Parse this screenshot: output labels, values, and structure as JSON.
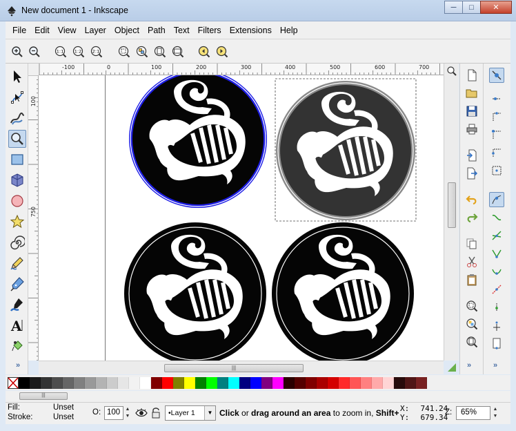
{
  "window": {
    "title": "New document 1 - Inkscape",
    "minimize": "─",
    "maximize": "□",
    "close": "✕"
  },
  "menu": [
    {
      "label": "File",
      "key": "F"
    },
    {
      "label": "Edit",
      "key": "E"
    },
    {
      "label": "View",
      "key": "V"
    },
    {
      "label": "Layer",
      "key": "L"
    },
    {
      "label": "Object",
      "key": "O"
    },
    {
      "label": "Path",
      "key": "P"
    },
    {
      "label": "Text",
      "key": "T"
    },
    {
      "label": "Filters",
      "key": "r"
    },
    {
      "label": "Extensions",
      "key": "x"
    },
    {
      "label": "Help",
      "key": "H"
    }
  ],
  "zoom_toolbar": {
    "zoom_1_1": "1:1",
    "zoom_1_2": "1:2",
    "zoom_2_1": "2:1"
  },
  "ruler": {
    "top_labels": [
      "-100",
      "0",
      "100",
      "200",
      "300",
      "400",
      "500",
      "600",
      "700"
    ],
    "left_labels": [
      "100",
      "750"
    ]
  },
  "toolbox_more": "»",
  "commands_more": "»",
  "snap_more": "»",
  "palette": {
    "colors": [
      "#000000",
      "#1a1a1a",
      "#333333",
      "#4d4d4d",
      "#666666",
      "#808080",
      "#999999",
      "#b3b3b3",
      "#cccccc",
      "#e6e6e6",
      "#f2f2f2",
      "#ffffff",
      "#800000",
      "#ff0000",
      "#808000",
      "#ffff00",
      "#008000",
      "#00ff00",
      "#008080",
      "#00ffff",
      "#000080",
      "#0000ff",
      "#800080",
      "#ff00ff",
      "#2b0000",
      "#550000",
      "#800000",
      "#aa0000",
      "#d40000",
      "#ff2a2a",
      "#ff5555",
      "#ff8080",
      "#ffaaaa",
      "#ffd5d5",
      "#280b0b",
      "#501616",
      "#782121"
    ]
  },
  "status": {
    "fill_label": "Fill:",
    "fill_value": "Unset",
    "stroke_label": "Stroke:",
    "stroke_value": "Unset",
    "opacity_label": "O:",
    "opacity_value": "100",
    "layer_value": "•Layer 1",
    "message_bold1": "Click",
    "message_mid1": " or ",
    "message_bold2": "drag around an area",
    "message_mid2": " to zoom in, ",
    "message_bold3": "Shift+cl",
    "x_label": "X:",
    "x_value": "741.24",
    "y_label": "Y:",
    "y_value": "679.34",
    "zoom_label": "Z:",
    "zoom_value": "65%"
  },
  "colors": {
    "selection_blue": "#1e1ee6",
    "gray_ring": "#8a8a8a",
    "dark_fill": "#333333"
  }
}
